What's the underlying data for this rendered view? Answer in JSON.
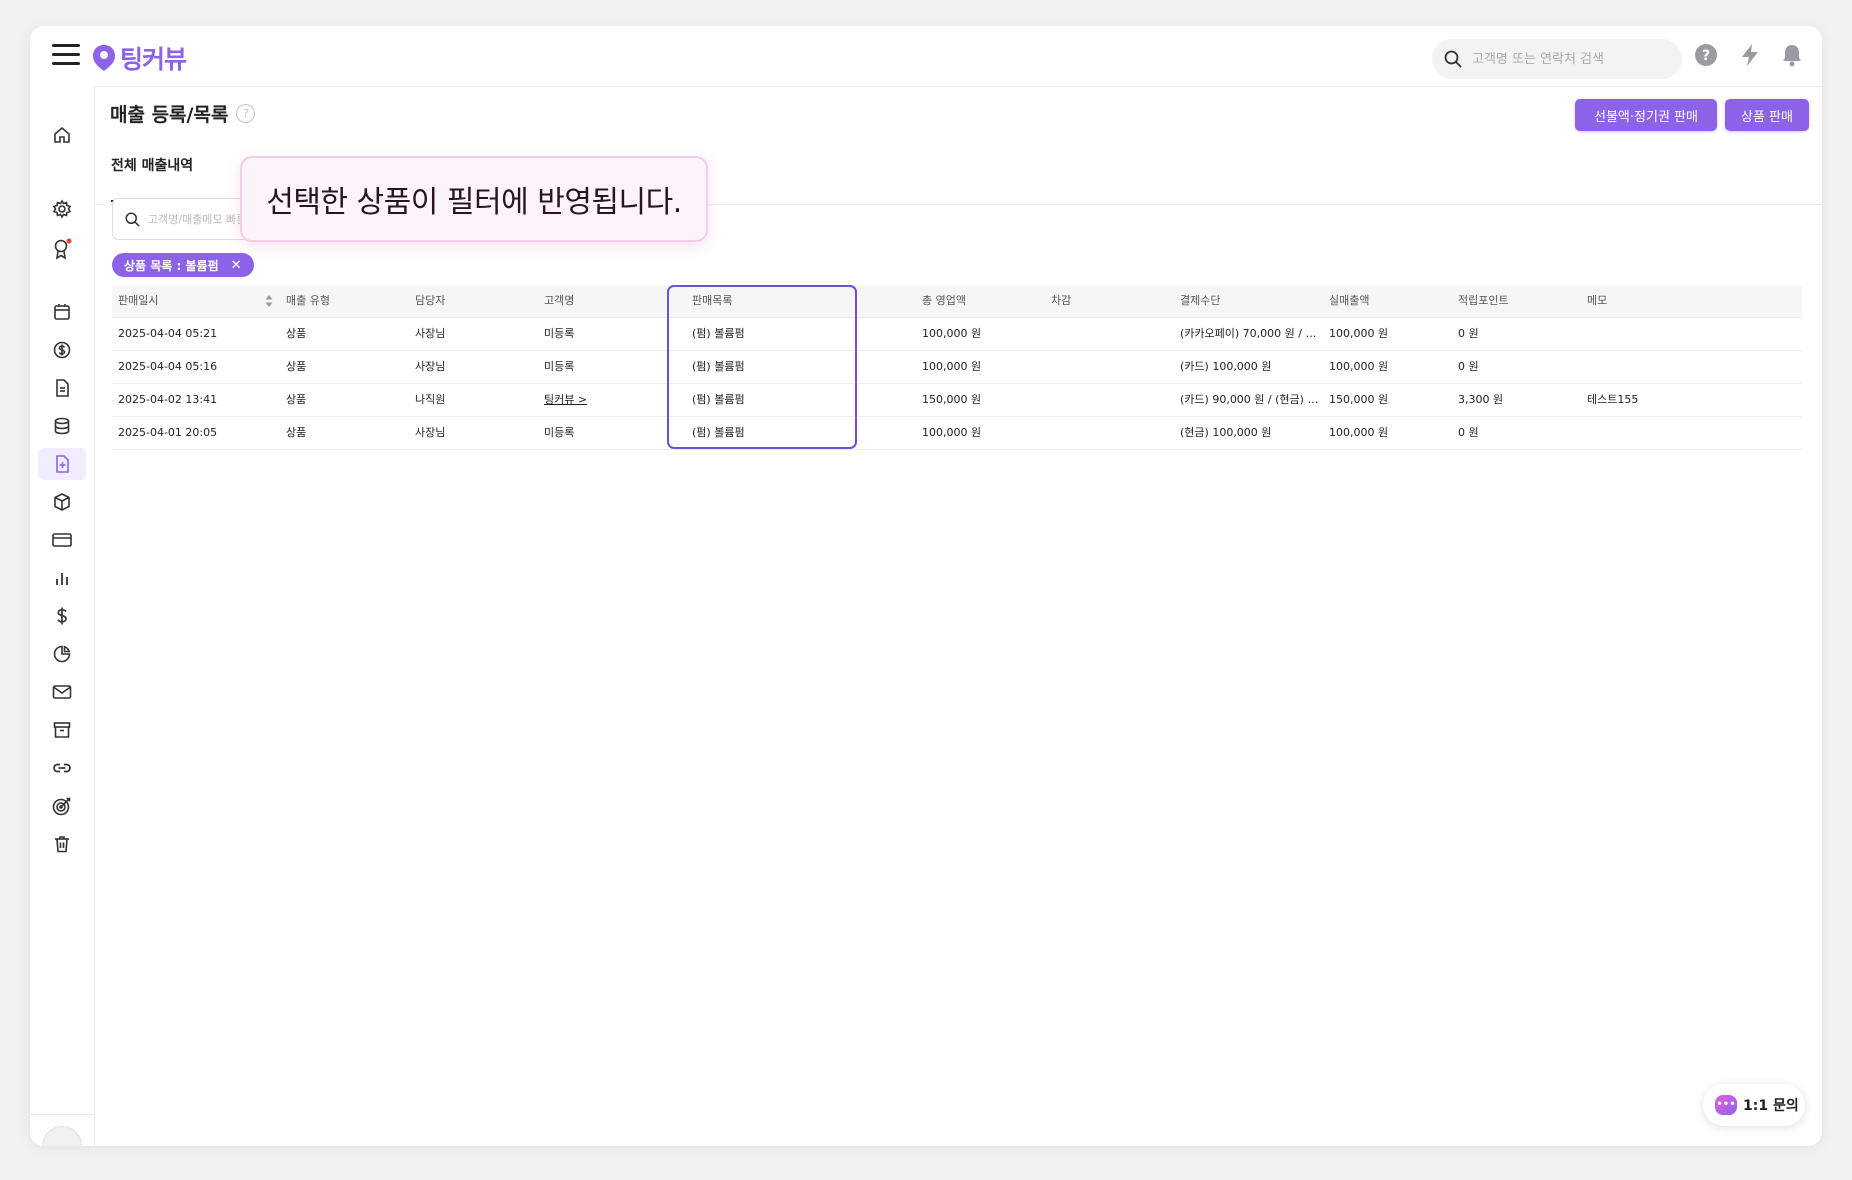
{
  "app": {
    "name": "팅커뷰"
  },
  "header": {
    "search_placeholder": "고객명 또는 연락처 검색",
    "icons": [
      "menu-icon",
      "help-icon",
      "lightning-icon",
      "bell-icon"
    ]
  },
  "sidebar": {
    "items": [
      {
        "name": "home-icon"
      },
      {
        "name": "gear-icon"
      },
      {
        "name": "award-icon",
        "badge": true
      },
      {
        "name": "calendar-icon"
      },
      {
        "name": "coin-icon"
      },
      {
        "name": "document-icon"
      },
      {
        "name": "database-icon"
      },
      {
        "name": "file-plus-icon",
        "active": true
      },
      {
        "name": "box-icon"
      },
      {
        "name": "card-icon"
      },
      {
        "name": "bar-chart-icon"
      },
      {
        "name": "dollar-icon"
      },
      {
        "name": "pie-chart-icon"
      },
      {
        "name": "mail-icon"
      },
      {
        "name": "archive-icon"
      },
      {
        "name": "link-icon"
      },
      {
        "name": "target-icon"
      },
      {
        "name": "trash-icon"
      }
    ]
  },
  "main": {
    "title": "매출 등록/목록",
    "buttons": {
      "prepaid": "선불액·정기권 판매",
      "product": "상품 판매"
    },
    "tab": "전체 매출내역",
    "filter_search_placeholder": "고객명/매출메모 빠른",
    "tooltip": "선택한 상품이 필터에 반영됩니다.",
    "chip": "상품 목록 : 볼륨펌",
    "chip_close": "✕"
  },
  "table": {
    "headers": [
      "판매일시",
      "매출 유형",
      "담당자",
      "고객명",
      "판매목록",
      "총 영업액",
      "차감",
      "결제수단",
      "실매출액",
      "적립포인트",
      "메모"
    ],
    "rows": [
      [
        "2025-04-04 05:21",
        "상품",
        "사장님",
        "미등록",
        "(펌) 볼륨펌",
        "100,000 원",
        "",
        "(카카오페이) 70,000 원 / (...",
        "100,000 원",
        "0 원",
        ""
      ],
      [
        "2025-04-04 05:16",
        "상품",
        "사장님",
        "미등록",
        "(펌) 볼륨펌",
        "100,000 원",
        "",
        "(카드) 100,000 원",
        "100,000 원",
        "0 원",
        ""
      ],
      [
        "2025-04-02 13:41",
        "상품",
        "나직원",
        "팅커뷰 >",
        "(펌) 볼륨펌",
        "150,000 원",
        "",
        "(카드) 90,000 원 / (현금) 6...",
        "150,000 원",
        "3,300 원",
        "테스트155"
      ],
      [
        "2025-04-01 20:05",
        "상품",
        "사장님",
        "미등록",
        "(펌) 볼륨펌",
        "100,000 원",
        "",
        "(현금) 100,000 원",
        "100,000 원",
        "0 원",
        ""
      ]
    ]
  },
  "inquiry": {
    "label": "1:1 문의",
    "bubble": "•••"
  },
  "colors": {
    "accent": "#8b62e8",
    "highlight": "#6f4fd9",
    "tooltip_bg": "#fdf4fb"
  }
}
